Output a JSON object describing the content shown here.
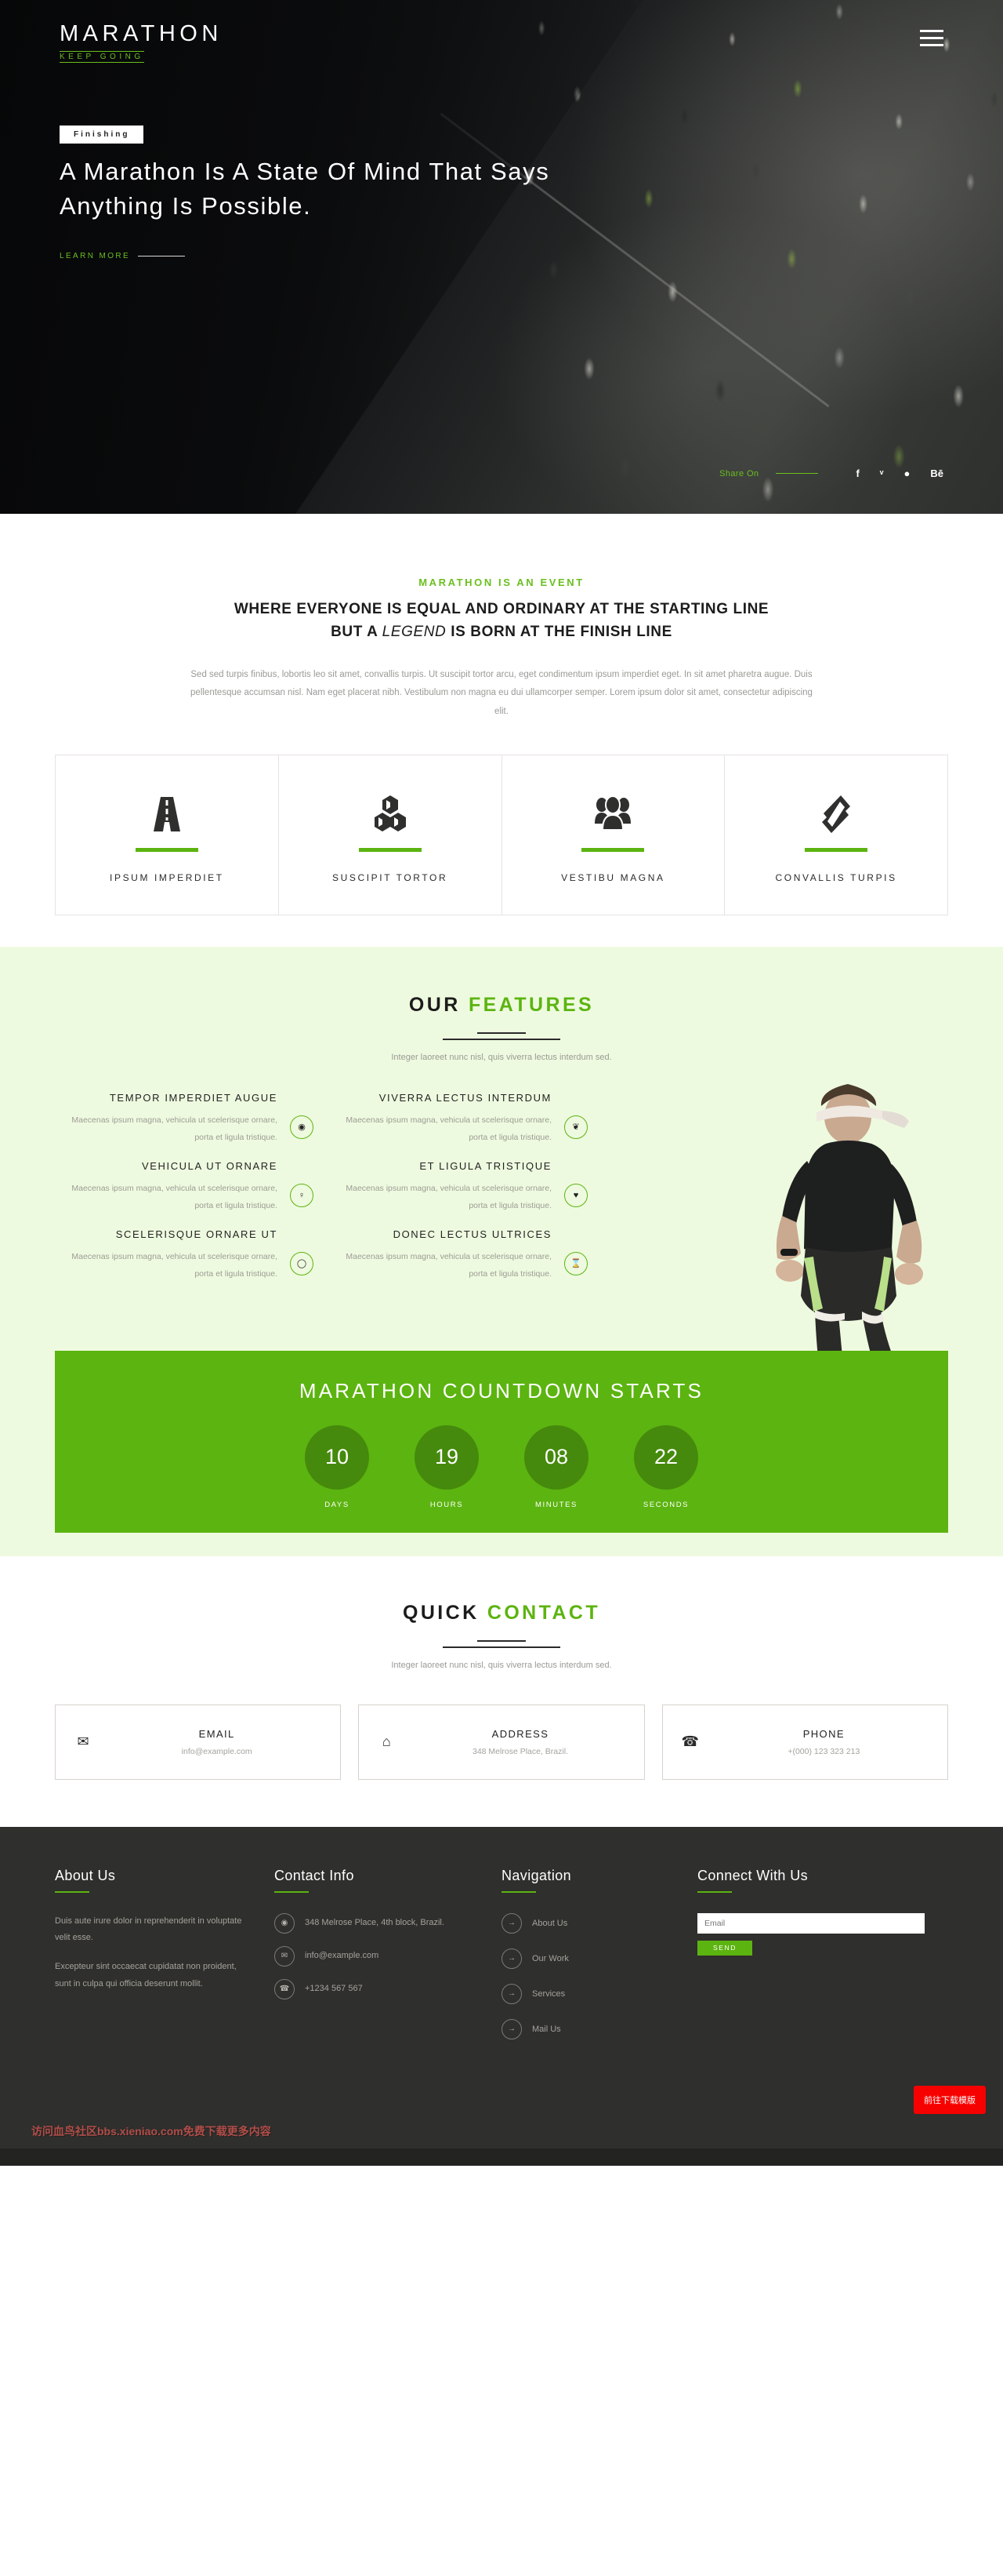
{
  "hero": {
    "brand": "MARATHON",
    "brand_sub": "KEEP GOING",
    "menu_icon": "hamburger-icon",
    "badge": "Finishing",
    "headline": "A Marathon Is A State Of Mind That Says Anything Is Possible.",
    "cta": "LEARN MORE",
    "share_label": "Share On",
    "socials": [
      {
        "name": "facebook",
        "glyph": "f"
      },
      {
        "name": "twitter",
        "glyph": "ᵛ"
      },
      {
        "name": "dribbble",
        "glyph": "●"
      },
      {
        "name": "behance",
        "glyph": "Bē"
      }
    ]
  },
  "intro": {
    "eyebrow": "MARATHON IS AN EVENT",
    "heading_line1": "WHERE EVERYONE IS EQUAL AND ORDINARY AT THE STARTING LINE",
    "heading_line2_a": "BUT A ",
    "heading_line2_em": "LEGEND",
    "heading_line2_b": " IS BORN AT THE FINISH LINE",
    "paragraph": "Sed sed turpis finibus, lobortis leo sit amet, convallis turpis. Ut suscipit tortor arcu, eget condimentum ipsum imperdiet eget. In sit amet pharetra augue. Duis pellentesque accumsan nisl. Nam eget placerat nibh. Vestibulum non magna eu dui ullamcorper semper. Lorem ipsum dolor sit amet, consectetur adipiscing elit."
  },
  "boxes": [
    {
      "icon": "road-icon",
      "label": "IPSUM IMPERDIET"
    },
    {
      "icon": "cubes-icon",
      "label": "SUSCIPIT TORTOR"
    },
    {
      "icon": "group-icon",
      "label": "VESTIBU MAGNA"
    },
    {
      "icon": "ticket-icon",
      "label": "CONVALLIS TURPIS"
    }
  ],
  "features": {
    "title_a": "OUR ",
    "title_b": "FEATURES",
    "subtitle": "Integer laoreet nunc nisl, quis viverra lectus interdum sed.",
    "items": [
      {
        "title": "TEMPOR IMPERDIET AUGUE",
        "desc": "Maecenas ipsum magna, vehicula ut scelerisque ornare, porta et ligula tristique.",
        "icon": "eye-icon",
        "glyph": "◉"
      },
      {
        "title": "VIVERRA LECTUS INTERDUM",
        "desc": "Maecenas ipsum magna, vehicula ut scelerisque ornare, porta et ligula tristique.",
        "icon": "leaf-icon",
        "glyph": "❦"
      },
      {
        "title": "VEHICULA UT ORNARE",
        "desc": "Maecenas ipsum magna, vehicula ut scelerisque ornare, porta et ligula tristique.",
        "icon": "pin-icon",
        "glyph": "♀"
      },
      {
        "title": "ET LIGULA TRISTIQUE",
        "desc": "Maecenas ipsum magna, vehicula ut scelerisque ornare, porta et ligula tristique.",
        "icon": "heartbeat-icon",
        "glyph": "♥"
      },
      {
        "title": "SCELERISQUE ORNARE UT",
        "desc": "Maecenas ipsum magna, vehicula ut scelerisque ornare, porta et ligula tristique.",
        "icon": "circle-icon",
        "glyph": "◯"
      },
      {
        "title": "DONEC LECTUS ULTRICES",
        "desc": "Maecenas ipsum magna, vehicula ut scelerisque ornare, porta et ligula tristique.",
        "icon": "hourglass-icon",
        "glyph": "⌛"
      }
    ]
  },
  "countdown": {
    "title": "MARATHON COUNTDOWN STARTS",
    "units": [
      {
        "value": "10",
        "label": "DAYS"
      },
      {
        "value": "19",
        "label": "HOURS"
      },
      {
        "value": "08",
        "label": "MINUTES"
      },
      {
        "value": "22",
        "label": "SECONDS"
      }
    ]
  },
  "quick_contact": {
    "title_a": "QUICK ",
    "title_b": "CONTACT",
    "subtitle": "Integer laoreet nunc nisl, quis viverra lectus interdum sed.",
    "cards": [
      {
        "icon": "envelope-icon",
        "glyph": "✉",
        "title": "EMAIL",
        "value": "info@example.com"
      },
      {
        "icon": "home-icon",
        "glyph": "⌂",
        "title": "ADDRESS",
        "value": "348 Melrose Place, Brazil."
      },
      {
        "icon": "phone-icon",
        "glyph": "☎",
        "title": "PHONE",
        "value": "+(000) 123 323 213"
      }
    ]
  },
  "footer": {
    "about": {
      "title": "About Us",
      "p1": "Duis aute irure dolor in reprehenderit in voluptate velit esse.",
      "p2": "Excepteur sint occaecat cupidatat non proident, sunt in culpa qui officia deserunt mollit."
    },
    "contact_info": {
      "title": "Contact Info",
      "lines": [
        {
          "icon": "map-pin-icon",
          "glyph": "◉",
          "text": "348 Melrose Place, 4th block, Brazil."
        },
        {
          "icon": "envelope-icon",
          "glyph": "✉",
          "text": "info@example.com"
        },
        {
          "icon": "phone-icon",
          "glyph": "☎",
          "text": "+1234 567 567"
        }
      ]
    },
    "navigation": {
      "title": "Navigation",
      "links": [
        "About Us",
        "Our Work",
        "Services",
        "Mail Us"
      ]
    },
    "connect": {
      "title": "Connect With Us",
      "email_placeholder": "Email",
      "email_value": "",
      "send_label": "SEND"
    },
    "download_button": "前往下载模版",
    "watermark": "访问血鸟社区bbs.xieniao.com免费下载更多内容"
  },
  "colors": {
    "green": "#5cb410",
    "green_light": "#6abf1f",
    "green_bg": "#eefadf",
    "dark": "#2f2f2d",
    "red": "#f70000"
  }
}
